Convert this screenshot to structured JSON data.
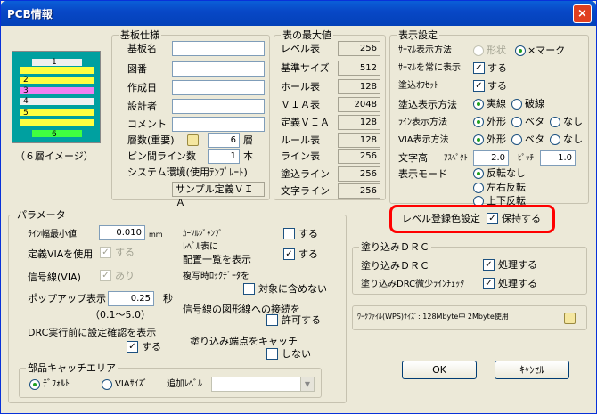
{
  "window": {
    "title": "PCB情報",
    "close_label": "×"
  },
  "board_image": {
    "caption": "（６層イメージ）",
    "layers": [
      "1",
      "2",
      "3",
      "4",
      "5",
      "6"
    ]
  },
  "board_spec": {
    "title": "基板仕様",
    "fields": [
      {
        "label": "基板名",
        "value": ""
      },
      {
        "label": "図番",
        "value": ""
      },
      {
        "label": "作成日",
        "value": ""
      },
      {
        "label": "設計者",
        "value": ""
      },
      {
        "label": "コメント",
        "value": ""
      }
    ],
    "layers_label": "層数(重要)",
    "layers_value": "6",
    "layers_unit": "層",
    "pin_label": "ピン間ライン数",
    "pin_value": "1",
    "pin_unit": "本",
    "env_label": "システム環境(使用ﾃﾝﾌﾟﾚｰﾄ)",
    "env_value": "サンプル定義ＶＩＡ"
  },
  "table_max": {
    "title": "表の最大値",
    "rows": [
      {
        "label": "レベル表",
        "value": "256"
      },
      {
        "label": "基準サイズ",
        "value": "512"
      },
      {
        "label": "ホール表",
        "value": "128"
      },
      {
        "label": "ＶＩＡ表",
        "value": "2048"
      },
      {
        "label": "定義ＶＩＡ",
        "value": "128"
      },
      {
        "label": "ルール表",
        "value": "128"
      },
      {
        "label": "ライン表",
        "value": "256"
      },
      {
        "label": "塗込ライン",
        "value": "256"
      },
      {
        "label": "文字ライン",
        "value": "256"
      }
    ]
  },
  "display": {
    "title": "表示設定",
    "thermal_label": "ｻｰﾏﾙ表示方法",
    "thermal_opt1": "形状",
    "thermal_opt2": "×マーク",
    "thermal_always_label": "ｻｰﾏﾙを常に表示",
    "thermal_always_cb": "する",
    "offset_label": "塗込ｵﾌｾｯﾄ",
    "offset_cb": "する",
    "fill_label": "塗込表示方法",
    "fill_opt1": "実線",
    "fill_opt2": "破線",
    "line_label": "ﾗｲﾝ表示方法",
    "via_label": "VIA表示方法",
    "opt_outline": "外形",
    "opt_solid": "ベタ",
    "opt_none": "なし",
    "text_label": "文字高",
    "text_aspect_label": "ｱｽﾍﾟｸﾄ",
    "text_aspect": "2.0",
    "text_pitch_label": "ﾋﾟｯﾁ",
    "text_pitch": "1.0",
    "mode_label": "表示モード",
    "mode_opt1": "反転なし",
    "mode_opt2": "左右反転",
    "mode_opt3": "上下反転",
    "level_color_label": "レベル登録色設定",
    "level_color_cb": "保持する"
  },
  "params": {
    "title": "パラメータ",
    "min_width_label": "ﾗｲﾝ幅最小値",
    "min_width_value": "0.010",
    "min_width_unit": "mm",
    "carsol_label": "ｶｰｿﾙｼﾞｬﾝﾌﾟ",
    "carsol_cb": "する",
    "def_via_label": "定義VIAを使用",
    "def_via_cb": "する",
    "level_list_label1": "ﾚﾍﾞﾙ表に",
    "level_list_label2": "配置一覧を表示",
    "level_list_cb": "する",
    "signal_via_label": "信号線(VIA)",
    "signal_via_cb": "あり",
    "copy_lock_label": "複写時ﾛｯｸﾃﾞｰﾀを",
    "copy_lock_cb": "対象に含めない",
    "popup_label": "ポップアップ表示",
    "popup_value": "0.25",
    "popup_unit": "秒",
    "popup_range": "（0.1～5.0）",
    "signal_shape_label": "信号線の図形線への接続を",
    "signal_shape_cb": "許可する",
    "drc_confirm_label": "DRC実行前に設定確認を表示",
    "drc_confirm_cb": "する",
    "fill_catch_label": "塗り込み端点をキャッチ",
    "fill_catch_cb": "しない"
  },
  "catch_area": {
    "title": "部品キャッチエリア",
    "opt1": "ﾃﾞﾌｫﾙﾄ",
    "opt2": "VIAｻｲｽﾞ",
    "add_label": "追加ﾚﾍﾞﾙ"
  },
  "fill_drc": {
    "title": "塗り込みＤＲＣ",
    "row1_label": "塗り込みＤＲＣ",
    "row1_cb": "処理する",
    "row2_label": "塗り込みDRC微少ﾗｲﾝﾁｪｯｸ",
    "row2_cb": "処理する"
  },
  "work_file": {
    "label": "ﾜｰｸﾌｧｲﾙ(WPS)ｻｲｽﾞ: 128Mbyte中 2Mbyte使用"
  },
  "buttons": {
    "ok": "OK",
    "cancel": "ｷｬﾝｾﾙ"
  },
  "colors": {
    "highlight": "#ff0000",
    "title_bar": "#0848c7"
  }
}
